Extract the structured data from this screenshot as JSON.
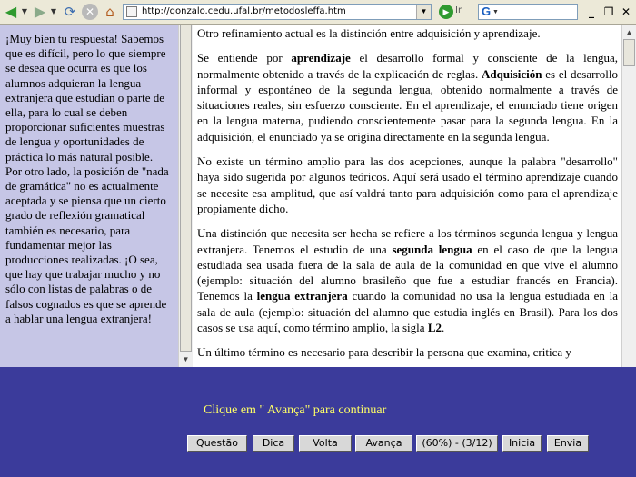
{
  "toolbar": {
    "url": "http://gonzalo.cedu.ufal.br/metodosleffa.htm",
    "go_label": "Ir",
    "search_logo": "G"
  },
  "left_panel": {
    "text": "¡Muy bien tu respuesta! Sabemos que es difícil, pero lo que siempre se desea que ocurra es que los alumnos adquieran la lengua extranjera que estudian o parte de ella, para lo cual se deben proporcionar suficientes muestras de lengua y oportunidades de práctica lo más natural posible. Por otro lado, la posición de \"nada de gramática\" no es actualmente aceptada y se piensa que un cierto grado de reflexión gramatical también es necesario, para fundamentar mejor las producciones realizadas. ¡O sea, que hay que trabajar mucho y no sólo con listas de palabras o de falsos cognados es que se aprende a hablar una lengua extranjera!"
  },
  "main": {
    "p1": "Otro refinamiento actual es la distinción entre adquisición y aprendizaje.",
    "p2": {
      "t1": "Se entiende por ",
      "b1": "aprendizaje",
      "t2": " el desarrollo formal y consciente de la lengua, normalmente obtenido a través de la explicación de reglas. ",
      "b2": "Adquisición",
      "t3": " es el desarrollo informal y espontáneo de la segunda lengua, obtenido normalmente a través de situaciones reales, sin esfuerzo consciente. En el aprendizaje, el enunciado tiene origen en la lengua materna, pudiendo conscientemente pasar para la segunda lengua. En la adquisición, el enunciado ya se origina directamente en la segunda lengua."
    },
    "p3": "No existe un término amplio para las dos acepciones, aunque la palabra \"desarrollo\" haya sido sugerida por algunos teóricos. Aquí será usado el término aprendizaje cuando se necesite esa amplitud, que así valdrá tanto para adquisición como para el aprendizaje propiamente dicho.",
    "p4": {
      "t1": "Una distinción que necesita ser hecha se refiere a los términos segunda lengua y lengua extranjera. Tenemos el estudio de una ",
      "b1": "segunda lengua",
      "t2": " en el caso de que la lengua estudiada sea usada fuera de la sala de aula de la comunidad en que vive el alumno (ejemplo: situación del alumno brasileño que fue a estudiar francés en Francia). Tenemos la ",
      "b2": "lengua extranjera",
      "t3": " cuando la comunidad no usa la lengua estudiada en la sala de aula (ejemplo: situación del alumno que estudia inglés en Brasil). Para los dos casos se usa aquí, como término amplio, la sigla ",
      "b3": "L2",
      "t4": "."
    },
    "p5": "Un último término es necesario para describir la persona que examina, critica y"
  },
  "footer": {
    "message": "Clique em \" Avança\" para continuar",
    "buttons": {
      "questao": "Questão",
      "dica": "Dica",
      "volta": "Volta",
      "avanca": "Avança",
      "progress": "(60%) - (3/12)",
      "inicia": "Inicia",
      "envia": "Envia"
    }
  }
}
